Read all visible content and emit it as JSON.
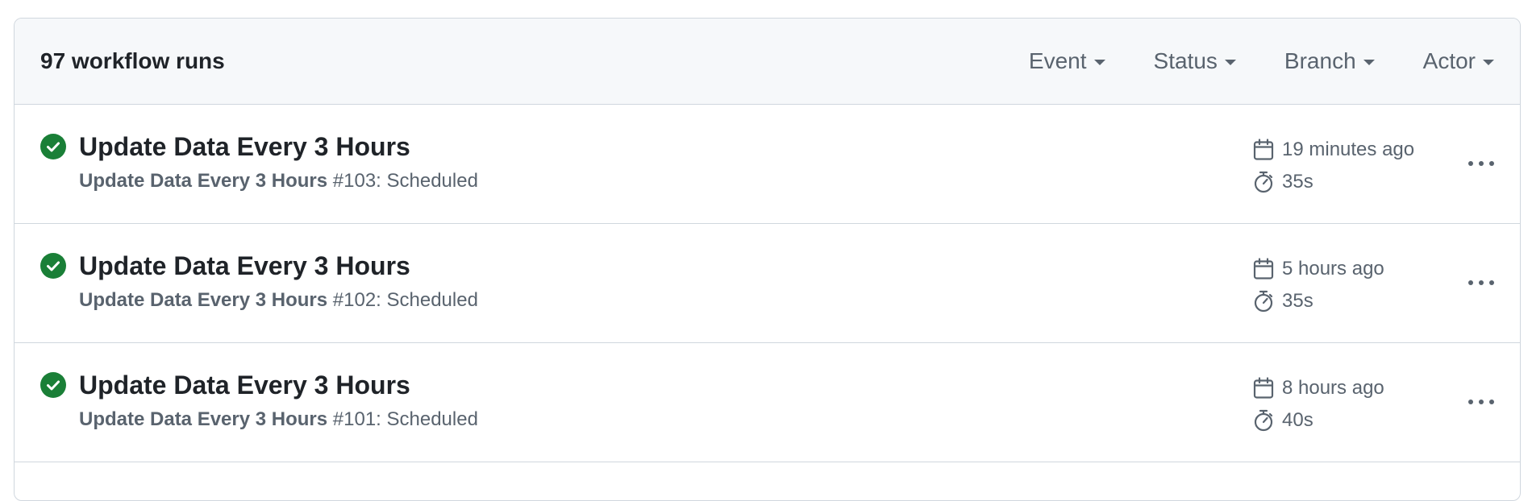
{
  "header": {
    "runs_count": "97 workflow runs",
    "filters": [
      {
        "label": "Event"
      },
      {
        "label": "Status"
      },
      {
        "label": "Branch"
      },
      {
        "label": "Actor"
      }
    ]
  },
  "runs": [
    {
      "status": "success",
      "title": "Update Data Every 3 Hours",
      "workflow_name": "Update Data Every 3 Hours",
      "run_suffix": "#103: Scheduled",
      "time_ago": "19 minutes ago",
      "duration": "35s"
    },
    {
      "status": "success",
      "title": "Update Data Every 3 Hours",
      "workflow_name": "Update Data Every 3 Hours",
      "run_suffix": "#102: Scheduled",
      "time_ago": "5 hours ago",
      "duration": "35s"
    },
    {
      "status": "success",
      "title": "Update Data Every 3 Hours",
      "workflow_name": "Update Data Every 3 Hours",
      "run_suffix": "#101: Scheduled",
      "time_ago": "8 hours ago",
      "duration": "40s"
    }
  ],
  "icons": {
    "status": "check-circle-fill-icon",
    "time": "calendar-icon",
    "duration": "stopwatch-icon",
    "menu": "kebab-horizontal-icon"
  },
  "colors": {
    "success": "#1a7f37",
    "header_bg": "#f6f8fa",
    "border": "#d0d7de",
    "muted_text": "#59636e",
    "primary_text": "#1f2328"
  }
}
